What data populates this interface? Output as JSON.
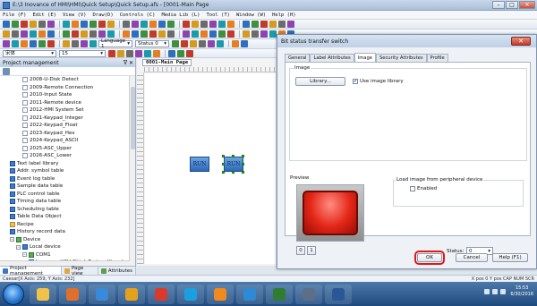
{
  "window": {
    "title": "E:\\3 Inovance of HMI\\HMI\\Quick Setup\\Quick Setup.afs - [0001-Main Page",
    "controls": [
      "–",
      "□",
      "✕"
    ]
  },
  "menu": [
    "File (F)",
    "Edit (E)",
    "View (V)",
    "Draw(D)",
    "Controls (C)",
    "Media Lib (L)",
    "Tool (T)",
    "Window (W)",
    "Help (H)"
  ],
  "toolbar": {
    "font_name": "宋体",
    "font_size": "15",
    "language_label": "Language 1",
    "status_label": "Status 0",
    "colors": [
      "#2e6fbd",
      "#3f8f3f",
      "#c23b2a",
      "#d59a1e",
      "#6b6b6b",
      "#8e44ad",
      "#1b9aaa",
      "#e67e22"
    ]
  },
  "project_panel": {
    "title": "Project management",
    "items": [
      {
        "label": "2008-U-Disk Detect",
        "icon": "doc",
        "level": 3
      },
      {
        "label": "2009-Remote Connection",
        "icon": "doc",
        "level": 3
      },
      {
        "label": "2010-Input State",
        "icon": "doc",
        "level": 3
      },
      {
        "label": "2011-Remote device",
        "icon": "doc",
        "level": 3
      },
      {
        "label": "2012-HMI System Set",
        "icon": "doc",
        "level": 3
      },
      {
        "label": "2021-Keypad_Integer",
        "icon": "doc",
        "level": 3
      },
      {
        "label": "2022-Keypad_Float",
        "icon": "doc",
        "level": 3
      },
      {
        "label": "2023-Keypad_Hex",
        "icon": "doc",
        "level": 3
      },
      {
        "label": "2024-Keypad_ASCII",
        "icon": "doc",
        "level": 3
      },
      {
        "label": "2025-ASC_Upper",
        "icon": "doc",
        "level": 3
      },
      {
        "label": "2026-ASC_Lower",
        "icon": "doc",
        "level": 3
      },
      {
        "label": "Text label library",
        "icon": "blue",
        "level": 1
      },
      {
        "label": "Addr. symbol table",
        "icon": "blue",
        "level": 1
      },
      {
        "label": "Event log table",
        "icon": "blue",
        "level": 1
      },
      {
        "label": "Sample data table",
        "icon": "blue",
        "level": 1
      },
      {
        "label": "PLC control table",
        "icon": "blue",
        "level": 1
      },
      {
        "label": "Timing data table",
        "icon": "blue",
        "level": 1
      },
      {
        "label": "Scheduling table",
        "icon": "blue",
        "level": 1
      },
      {
        "label": "Table Data Object",
        "icon": "blue",
        "level": 1
      },
      {
        "label": "Recipe",
        "icon": "folder",
        "level": 1
      },
      {
        "label": "History record data",
        "icon": "blue",
        "level": 1
      },
      {
        "label": "Device",
        "icon": "green",
        "level": 1
      },
      {
        "label": "Local device",
        "icon": "blue",
        "level": 2
      },
      {
        "label": "COM1",
        "icon": "green",
        "level": 3
      },
      {
        "label": "Inovance H3U QLink Protocol(Local",
        "icon": "blue",
        "level": 4
      },
      {
        "label": "Addr. list",
        "icon": "doc",
        "level": 1
      }
    ],
    "tabs": [
      "Project management",
      "Page view",
      "Attributes"
    ]
  },
  "editor": {
    "tab_label": "0001-Main Page",
    "buttons": [
      {
        "label": "RUN",
        "selected": false
      },
      {
        "label": "RUN",
        "selected": true
      }
    ]
  },
  "status_bar": {
    "left": "Caesar[X Axis: 259, Y Axis: 232]",
    "right": "X pos 0  Y pos CAP  NUM  SCR"
  },
  "taskbar": {
    "apps": [
      "folder",
      "media",
      "explorer",
      "chrome",
      "pdf",
      "skype",
      "hmi",
      "browser",
      "excel",
      "tool",
      "word"
    ],
    "app_colors": [
      "#f1c24a",
      "#e06f2c",
      "#3b8ad9",
      "#e4a11b",
      "#d93a2b",
      "#1aa0e0",
      "#f08a1c",
      "#2d8ad3",
      "#2e7d32",
      "#5d6f86",
      "#2b5797"
    ],
    "time": "15:53",
    "date": "6/30/2016"
  },
  "dialog": {
    "title": "Bit status transfer switch",
    "close_label": "✕",
    "tabs": [
      "General",
      "Label Attributes",
      "Image",
      "Security Attributes",
      "Profile"
    ],
    "active_tab": "Image",
    "image_group_label": "Image",
    "library_button": "Library...",
    "use_image_library_label": "Use image library",
    "use_image_library_checked": true,
    "preview_label": "Preview",
    "load_image_label": "Load image from peripheral device",
    "enabled_label": "Enabled",
    "enabled_checked": false,
    "state_buttons": [
      "0",
      "1"
    ],
    "status_label": "Status:",
    "status_value": "0",
    "ok_label": "OK",
    "cancel_label": "Cancel",
    "help_label": "Help (F1)"
  }
}
